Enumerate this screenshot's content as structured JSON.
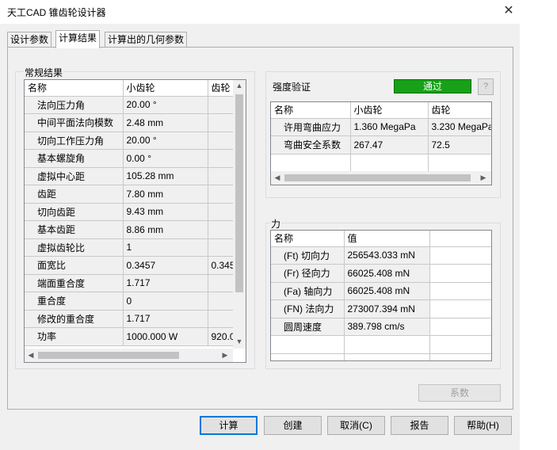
{
  "window": {
    "title": "天工CAD 锥齿轮设计器",
    "close_glyph": "✕"
  },
  "tabs": [
    {
      "label": "设计参数"
    },
    {
      "label": "计算结果"
    },
    {
      "label": "计算出的几何参数"
    }
  ],
  "general_results": {
    "title": "常规结果",
    "columns": [
      "名称",
      "小齿轮",
      "齿轮"
    ],
    "rows": [
      {
        "name": "法向压力角",
        "pinion": "20.00 °",
        "gear": ""
      },
      {
        "name": "中间平面法向模数",
        "pinion": "2.48 mm",
        "gear": ""
      },
      {
        "name": "切向工作压力角",
        "pinion": "20.00 °",
        "gear": ""
      },
      {
        "name": "基本螺旋角",
        "pinion": "0.00 °",
        "gear": ""
      },
      {
        "name": "虚拟中心距",
        "pinion": "105.28 mm",
        "gear": ""
      },
      {
        "name": "齿距",
        "pinion": "7.80 mm",
        "gear": ""
      },
      {
        "name": "切向齿距",
        "pinion": "9.43 mm",
        "gear": ""
      },
      {
        "name": "基本齿距",
        "pinion": "8.86 mm",
        "gear": ""
      },
      {
        "name": "虚拟齿轮比",
        "pinion": "1",
        "gear": ""
      },
      {
        "name": "面宽比",
        "pinion": "0.3457",
        "gear": "0.345"
      },
      {
        "name": "端面重合度",
        "pinion": "1.717",
        "gear": ""
      },
      {
        "name": "重合度",
        "pinion": "0",
        "gear": ""
      },
      {
        "name": "修改的重合度",
        "pinion": "1.717",
        "gear": ""
      },
      {
        "name": "功率",
        "pinion": "1000.000 W",
        "gear": "920.0"
      }
    ]
  },
  "strength": {
    "title": "强度验证",
    "status": "通过",
    "help": "?",
    "columns": [
      "名称",
      "小齿轮",
      "齿轮"
    ],
    "rows": [
      {
        "name": "许用弯曲应力",
        "pinion": "1.360 MegaPa",
        "gear": "3.230 MegaPa"
      },
      {
        "name": "弯曲安全系数",
        "pinion": "267.47",
        "gear": "72.5"
      }
    ]
  },
  "force": {
    "title": "力",
    "columns": [
      "名称",
      "值",
      ""
    ],
    "rows": [
      {
        "name": "(Ft) 切向力",
        "value": "256543.033 mN"
      },
      {
        "name": "(Fr) 径向力",
        "value": "66025.408 mN"
      },
      {
        "name": "(Fa) 轴向力",
        "value": "66025.408 mN"
      },
      {
        "name": "(FN) 法向力",
        "value": "273007.394 mN"
      },
      {
        "name": "圆周速度",
        "value": "389.798 cm/s"
      }
    ]
  },
  "coefficient_button": "系数",
  "buttons": {
    "calculate": "计算",
    "create": "创建",
    "cancel": "取消(C)",
    "report": "报告",
    "help": "帮助(H)"
  },
  "colors": {
    "pass": "#18a018",
    "default_focus": "#0078d7"
  }
}
